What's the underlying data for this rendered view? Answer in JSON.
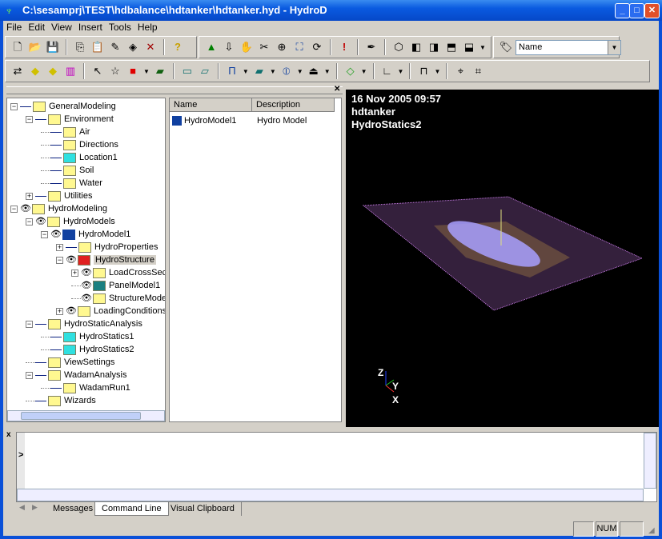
{
  "window": {
    "title": "C:\\sesamprj\\TEST\\hdbalance\\hdtanker\\hdtanker.hyd - HydroD"
  },
  "menu": [
    "File",
    "Edit",
    "View",
    "Insert",
    "Tools",
    "Help"
  ],
  "toolbar": {
    "name_select": "Name"
  },
  "tree": [
    {
      "label": "GeneralModeling",
      "level": 0,
      "exp": "-",
      "eye": false,
      "icon": "folder"
    },
    {
      "label": "Environment",
      "level": 1,
      "exp": "-",
      "eye": false,
      "icon": "folder"
    },
    {
      "label": "Air",
      "level": 2,
      "exp": "",
      "eye": false,
      "icon": "folder"
    },
    {
      "label": "Directions",
      "level": 2,
      "exp": "",
      "eye": false,
      "icon": "folder"
    },
    {
      "label": "Location1",
      "level": 2,
      "exp": "",
      "eye": false,
      "icon": "location"
    },
    {
      "label": "Soil",
      "level": 2,
      "exp": "",
      "eye": false,
      "icon": "folder"
    },
    {
      "label": "Water",
      "level": 2,
      "exp": "",
      "eye": false,
      "icon": "folder"
    },
    {
      "label": "Utilities",
      "level": 1,
      "exp": "+",
      "eye": false,
      "icon": "folder"
    },
    {
      "label": "HydroModeling",
      "level": 0,
      "exp": "-",
      "eye": true,
      "icon": "folder"
    },
    {
      "label": "HydroModels",
      "level": 1,
      "exp": "-",
      "eye": true,
      "icon": "folder"
    },
    {
      "label": "HydroModel1",
      "level": 2,
      "exp": "-",
      "eye": true,
      "icon": "model"
    },
    {
      "label": "HydroProperties",
      "level": 3,
      "exp": "+",
      "eye": false,
      "icon": "folder"
    },
    {
      "label": "HydroStructure",
      "level": 3,
      "exp": "-",
      "eye": true,
      "icon": "structure",
      "selected": true
    },
    {
      "label": "LoadCrossSec",
      "level": 4,
      "exp": "+",
      "eye": true,
      "icon": "folder"
    },
    {
      "label": "PanelModel1",
      "level": 4,
      "exp": "",
      "eye": true,
      "icon": "panel"
    },
    {
      "label": "StructureMode",
      "level": 4,
      "exp": "",
      "eye": true,
      "icon": "wire"
    },
    {
      "label": "LoadingConditions",
      "level": 3,
      "exp": "+",
      "eye": true,
      "icon": "folder"
    },
    {
      "label": "HydroStaticAnalysis",
      "level": 1,
      "exp": "-",
      "eye": false,
      "icon": "folder"
    },
    {
      "label": "HydroStatics1",
      "level": 2,
      "exp": "",
      "eye": false,
      "icon": "statics"
    },
    {
      "label": "HydroStatics2",
      "level": 2,
      "exp": "",
      "eye": false,
      "icon": "statics"
    },
    {
      "label": "ViewSettings",
      "level": 1,
      "exp": "",
      "eye": false,
      "icon": "folder"
    },
    {
      "label": "WadamAnalysis",
      "level": 1,
      "exp": "-",
      "eye": false,
      "icon": "folder"
    },
    {
      "label": "WadamRun1",
      "level": 2,
      "exp": "",
      "eye": false,
      "icon": "hourglass"
    },
    {
      "label": "Wizards",
      "level": 1,
      "exp": "",
      "eye": false,
      "icon": "folder"
    }
  ],
  "list": {
    "columns": [
      "Name",
      "Description"
    ],
    "rows": [
      {
        "name": "HydroModel1",
        "description": "Hydro Model"
      }
    ]
  },
  "view": {
    "line1": "16 Nov 2005 09:57",
    "line2": "hdtanker",
    "line3": "HydroStatics2",
    "axes": {
      "z": "Z",
      "y": "Y",
      "x": "X"
    }
  },
  "command": {
    "prompt": ">",
    "close": "x"
  },
  "tabs": [
    "Messages",
    "Command Line",
    "Visual Clipboard"
  ],
  "active_tab": "Command Line",
  "status": {
    "num": "NUM"
  }
}
